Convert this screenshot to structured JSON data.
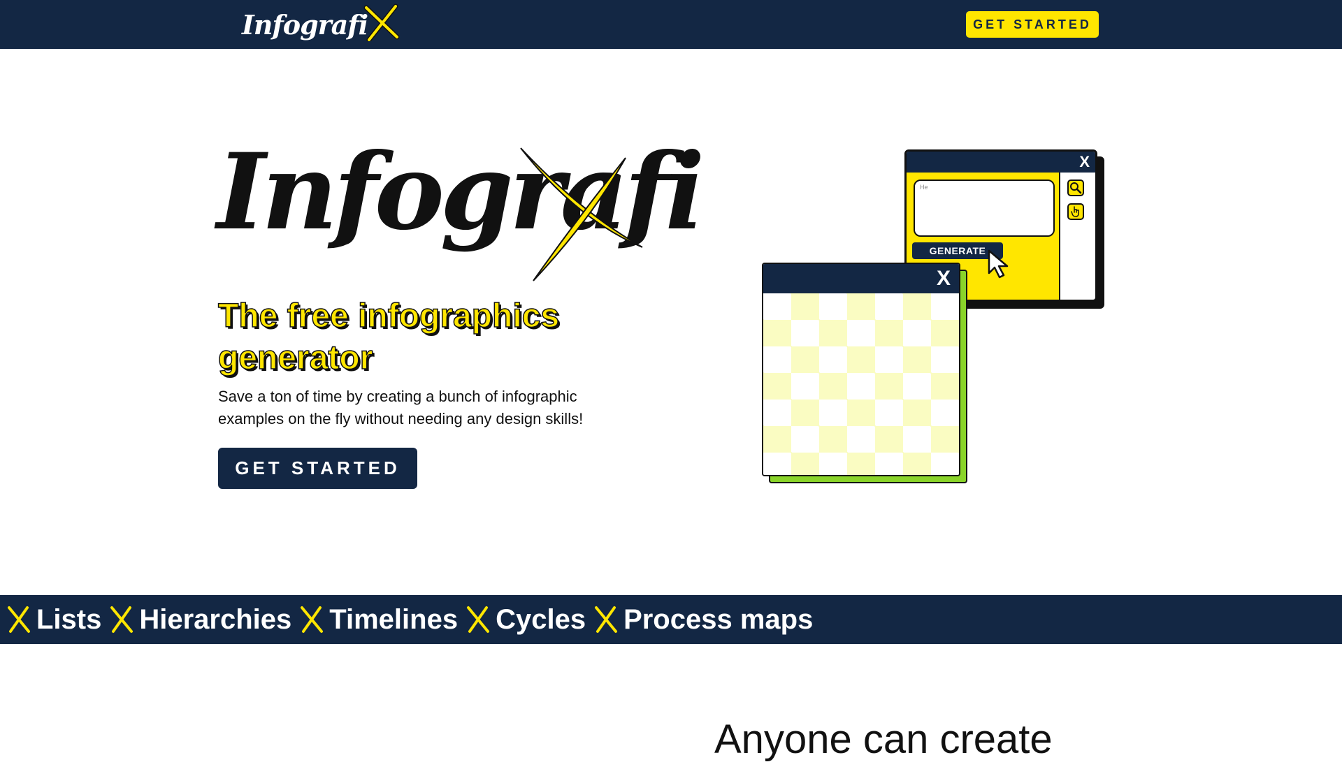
{
  "nav": {
    "logo_text": "Infografi",
    "logo_x_letter": "X",
    "cta_label": "GET STARTED"
  },
  "hero": {
    "logo_text": "Infografi",
    "logo_x_letter": "X",
    "tagline": "The free infographics generator",
    "description": "Save a ton of time by creating a bunch of infographic examples on the fly without needing any design skills!",
    "cta_label": "GET STARTED"
  },
  "illustration": {
    "back_window": {
      "close_label": "X",
      "prompt_text": "He",
      "generate_label": "GENERATE",
      "icons": [
        "search-icon",
        "hand-pointer-icon"
      ]
    },
    "front_window": {
      "close_label": "X"
    }
  },
  "strip": {
    "items": [
      {
        "label": "Lists"
      },
      {
        "label": "Hierarchies"
      },
      {
        "label": "Timelines"
      },
      {
        "label": "Cycles"
      },
      {
        "label": "Process maps"
      }
    ]
  },
  "section": {
    "heading": "Anyone can create"
  },
  "colors": {
    "navy": "#132744",
    "yellow": "#ffe600",
    "green": "#8ad42a",
    "checker_light": "#fafcc2"
  }
}
